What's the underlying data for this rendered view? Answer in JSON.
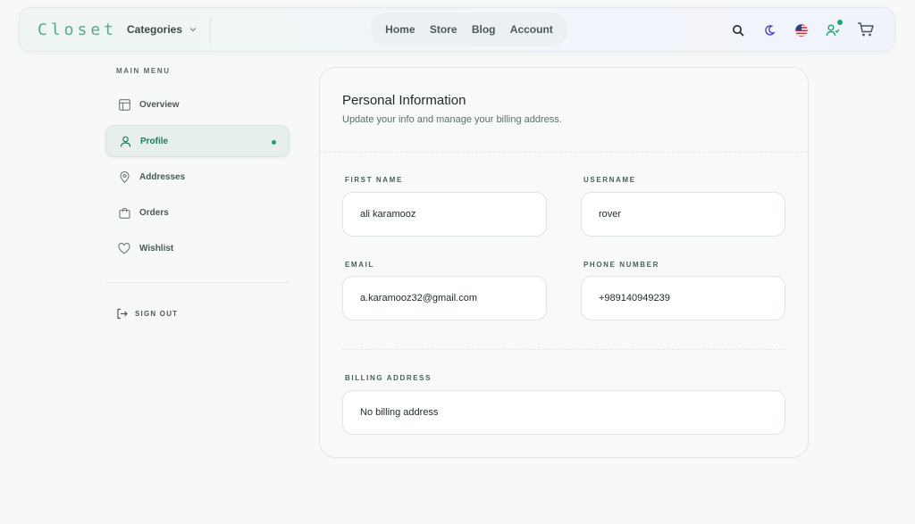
{
  "header": {
    "logo": "Closet",
    "categories_label": "Categories",
    "nav": [
      "Home",
      "Store",
      "Blog",
      "Account"
    ],
    "icons": [
      "search-icon",
      "moon-icon",
      "us-flag-icon",
      "user-check-icon",
      "cart-icon"
    ],
    "accent_color": "#17a673"
  },
  "sidebar": {
    "title": "MAIN MENU",
    "items": [
      {
        "label": "Overview",
        "icon": "layout-icon"
      },
      {
        "label": "Profile",
        "icon": "user-icon",
        "active": true
      },
      {
        "label": "Addresses",
        "icon": "map-pin-icon"
      },
      {
        "label": "Orders",
        "icon": "bag-icon"
      },
      {
        "label": "Wishlist",
        "icon": "heart-icon"
      }
    ],
    "signout": "SIGN OUT"
  },
  "card": {
    "title": "Personal Information",
    "subtitle": "Update your info and manage your billing address.",
    "fields": {
      "first_name": {
        "label": "FIRST NAME",
        "value": "ali karamooz"
      },
      "username": {
        "label": "USERNAME",
        "value": "rover"
      },
      "email": {
        "label": "EMAIL",
        "value": "a.karamooz32@gmail.com"
      },
      "phone": {
        "label": "PHONE NUMBER",
        "value": "+989140949239"
      },
      "billing": {
        "label": "BILLING ADDRESS",
        "value": "No billing address"
      }
    }
  }
}
